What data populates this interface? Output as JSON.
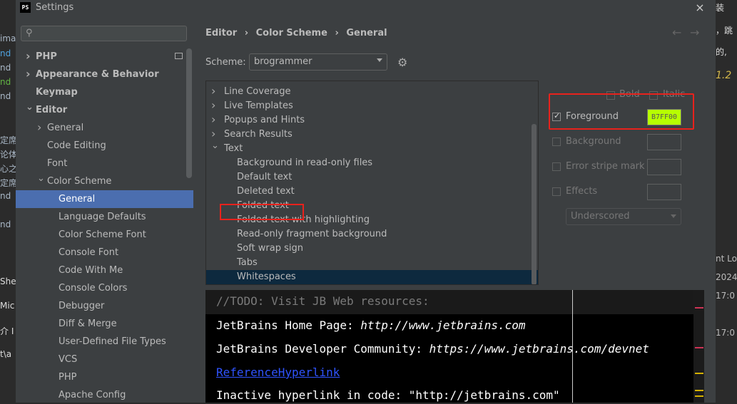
{
  "background": {
    "left_lines": [
      {
        "text": "ima",
        "color": "#a9b7c6"
      },
      {
        "text": "nd",
        "color": "#4fa3e0"
      },
      {
        "text": "nd",
        "color": "#a9b7c6"
      },
      {
        "text": "nd",
        "color": "#62b543"
      },
      {
        "text": "nd",
        "color": "#a9b7c6"
      },
      {
        "text": "定席早",
        "color": "#a9b7c6"
      },
      {
        "text": "论体",
        "color": "#a9b7c6"
      },
      {
        "text": "心之",
        "color": "#a9b7c6"
      },
      {
        "text": "定席流",
        "color": "#a9b7c6"
      },
      {
        "text": "nd",
        "color": "#a9b7c6"
      },
      {
        "text": "nd",
        "color": "#a9b7c6"
      },
      {
        "text": "She",
        "color": "#dddddd"
      },
      {
        "text": "Mic",
        "color": "#dddddd"
      },
      {
        "text": "介 I",
        "color": "#dddddd"
      },
      {
        "text": "t\\a",
        "color": "#dddddd"
      }
    ],
    "right_lines": [
      {
        "text": "装",
        "color": "#dddddd"
      },
      {
        "text": "，跳",
        "color": "#dddddd"
      },
      {
        "text": "的,",
        "color": "#dddddd"
      },
      {
        "text": "1.2",
        "color": "#d4b84a"
      },
      {
        "text": "nt Log",
        "color": "#bbbbbb"
      },
      {
        "text": "2024",
        "color": "#bbbbbb"
      },
      {
        "text": "17:0",
        "color": "#bbbbbb"
      },
      {
        "text": "17:0",
        "color": "#bbbbbb"
      }
    ]
  },
  "window": {
    "icon_text": "PS",
    "title": "Settings",
    "close_icon": "×"
  },
  "sidebar": {
    "search_icon": "⚲",
    "items": [
      {
        "label": "PHP",
        "arrow": "›",
        "bold": true
      },
      {
        "label": "Appearance & Behavior",
        "arrow": "›",
        "bold": true
      },
      {
        "label": "Keymap",
        "arrow": "",
        "bold": true
      },
      {
        "label": "Editor",
        "arrow": "⌄",
        "bold": true
      },
      {
        "label": "General",
        "arrow": "›",
        "bold": false
      },
      {
        "label": "Code Editing",
        "arrow": "",
        "bold": false
      },
      {
        "label": "Font",
        "arrow": "",
        "bold": false
      },
      {
        "label": "Color Scheme",
        "arrow": "⌄",
        "bold": false
      },
      {
        "label": "General",
        "arrow": "",
        "bold": false,
        "selected": true
      },
      {
        "label": "Language Defaults",
        "arrow": "",
        "bold": false
      },
      {
        "label": "Color Scheme Font",
        "arrow": "",
        "bold": false
      },
      {
        "label": "Console Font",
        "arrow": "",
        "bold": false
      },
      {
        "label": "Code With Me",
        "arrow": "",
        "bold": false
      },
      {
        "label": "Console Colors",
        "arrow": "",
        "bold": false
      },
      {
        "label": "Debugger",
        "arrow": "",
        "bold": false
      },
      {
        "label": "Diff & Merge",
        "arrow": "",
        "bold": false
      },
      {
        "label": "User-Defined File Types",
        "arrow": "",
        "bold": false
      },
      {
        "label": "VCS",
        "arrow": "",
        "bold": false
      },
      {
        "label": "PHP",
        "arrow": "",
        "bold": false
      },
      {
        "label": "Apache Config",
        "arrow": "",
        "bold": false
      }
    ]
  },
  "breadcrumb": {
    "items": [
      "Editor",
      "›",
      "Color Scheme",
      "›",
      "General"
    ],
    "back_icon": "←",
    "forward_icon": "→"
  },
  "scheme": {
    "label": "Scheme:",
    "value": "brogrammer",
    "gear_icon": "⚙"
  },
  "element_list": {
    "items": [
      {
        "label": "Line Coverage",
        "arrow": "›",
        "indent": 1
      },
      {
        "label": "Live Templates",
        "arrow": "›",
        "indent": 1
      },
      {
        "label": "Popups and Hints",
        "arrow": "›",
        "indent": 1
      },
      {
        "label": "Search Results",
        "arrow": "›",
        "indent": 1
      },
      {
        "label": "Text",
        "arrow": "⌄",
        "indent": 1
      },
      {
        "label": "Background in read-only files",
        "arrow": "",
        "indent": 2
      },
      {
        "label": "Default text",
        "arrow": "",
        "indent": 2
      },
      {
        "label": "Deleted text",
        "arrow": "",
        "indent": 2
      },
      {
        "label": "Folded text",
        "arrow": "",
        "indent": 2
      },
      {
        "label": "Folded text with highlighting",
        "arrow": "",
        "indent": 2
      },
      {
        "label": "Read-only fragment background",
        "arrow": "",
        "indent": 2
      },
      {
        "label": "Soft wrap sign",
        "arrow": "",
        "indent": 2
      },
      {
        "label": "Tabs",
        "arrow": "",
        "indent": 2
      },
      {
        "label": "Whitespaces",
        "arrow": "",
        "indent": 2,
        "selected": true
      }
    ]
  },
  "attributes": {
    "bold": {
      "label": "Bold",
      "checked": false
    },
    "italic": {
      "label": "Italic",
      "checked": false
    },
    "foreground": {
      "label": "Foreground",
      "checked": true,
      "color_value": "B7FF00",
      "color": "#b7ff00"
    },
    "background": {
      "label": "Background",
      "checked": false
    },
    "error_stripe": {
      "label": "Error stripe mark",
      "checked": false
    },
    "effects": {
      "label": "Effects",
      "checked": false
    },
    "effect_type": "Underscored"
  },
  "preview": {
    "comment": "//TODO: Visit JB Web resources:",
    "line2_prefix": "JetBrains Home Page: ",
    "line2_url": "http://www.jetbrains.com",
    "line3_prefix": "JetBrains Developer Community: ",
    "line3_url": "https://www.jetbrains.com/devnet",
    "line4_link": "ReferenceHyperlink",
    "line5": "Inactive hyperlink in code: \"http://jetbrains.com\""
  },
  "colors": {
    "highlight_red": "#e8221c",
    "selection_blue": "#4b6eaf",
    "foreground_swatch": "#b7ff00"
  }
}
